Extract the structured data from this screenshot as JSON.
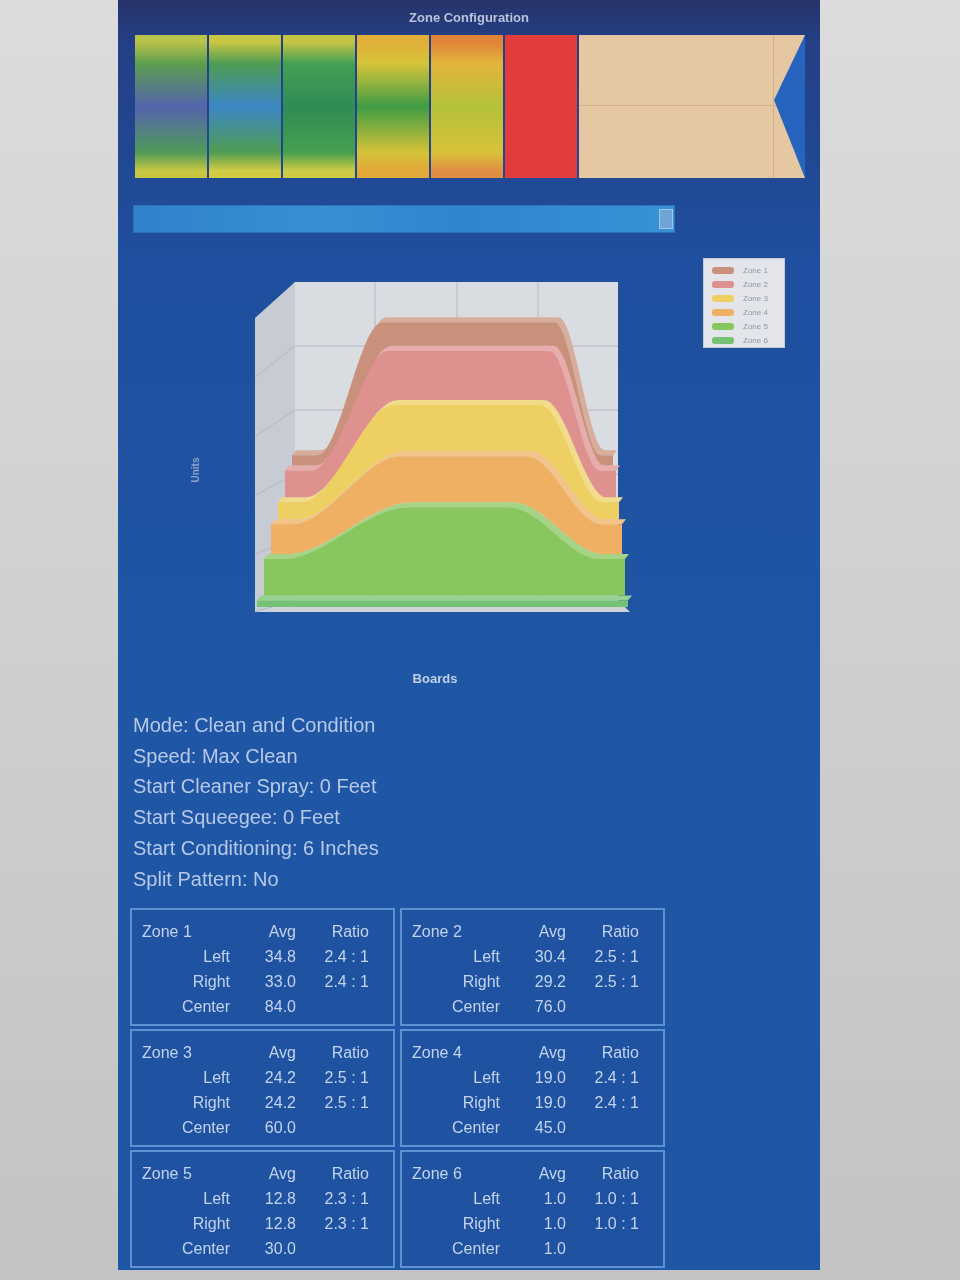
{
  "title": "Zone Configuration",
  "zone_strip": {
    "bars": [
      {
        "stripes": [
          {
            "color": "#b9c24a"
          },
          {
            "color": "#5c9e4e"
          },
          {
            "color": "#5464ac"
          },
          {
            "color": "#4f9a5a"
          },
          {
            "color": "#c7c640"
          }
        ]
      },
      {
        "stripes": [
          {
            "color": "#c8c645"
          },
          {
            "color": "#4e9c52"
          },
          {
            "color": "#3c86c4"
          },
          {
            "color": "#4f9c52"
          },
          {
            "color": "#d2cc42"
          }
        ]
      },
      {
        "stripes": [
          {
            "color": "#c4c444"
          },
          {
            "color": "#44a052"
          },
          {
            "color": "#2f8c56"
          },
          {
            "color": "#46a050"
          },
          {
            "color": "#cccc44"
          }
        ]
      },
      {
        "stripes": [
          {
            "color": "#e0b038"
          },
          {
            "color": "#d6c43a"
          },
          {
            "color": "#3f9c44"
          },
          {
            "color": "#d4c238"
          },
          {
            "color": "#e2a838"
          }
        ]
      },
      {
        "stripes": [
          {
            "color": "#e0843a"
          },
          {
            "color": "#e2b43a"
          },
          {
            "color": "#b4c23a"
          },
          {
            "color": "#d8c23a"
          },
          {
            "color": "#e08e44"
          }
        ]
      },
      {
        "stripes": [
          {
            "color": "#e23c3c"
          }
        ]
      }
    ]
  },
  "position_slider": {
    "level": 1
  },
  "chart": {
    "y_axis_title": "Units",
    "x_axis_title": "Boards",
    "legend": [
      {
        "label": "Zone 1",
        "color": "#c9917b"
      },
      {
        "label": "Zone 2",
        "color": "#df9190"
      },
      {
        "label": "Zone 3",
        "color": "#eed062"
      },
      {
        "label": "Zone 4",
        "color": "#efb063"
      },
      {
        "label": "Zone 5",
        "color": "#88c65e"
      },
      {
        "label": "Zone 6",
        "color": "#74c272"
      }
    ]
  },
  "settings": [
    "Mode: Clean and Condition",
    "Speed: Max Clean",
    "Start Cleaner Spray: 0 Feet",
    "Start Squeegee: 0 Feet",
    "Start Conditioning: 6 Inches",
    "Split Pattern: No"
  ],
  "zones": [
    {
      "name": "Zone 1",
      "columns": [
        "Avg",
        "Ratio"
      ],
      "rows": [
        {
          "label": "Left",
          "avg": "34.8",
          "ratio": "2.4 : 1"
        },
        {
          "label": "Right",
          "avg": "33.0",
          "ratio": "2.4 : 1"
        },
        {
          "label": "Center",
          "avg": "84.0"
        }
      ]
    },
    {
      "name": "Zone 2",
      "columns": [
        "Avg",
        "Ratio"
      ],
      "rows": [
        {
          "label": "Left",
          "avg": "30.4",
          "ratio": "2.5 : 1"
        },
        {
          "label": "Right",
          "avg": "29.2",
          "ratio": "2.5 : 1"
        },
        {
          "label": "Center",
          "avg": "76.0"
        }
      ]
    },
    {
      "name": "Zone 3",
      "columns": [
        "Avg",
        "Ratio"
      ],
      "rows": [
        {
          "label": "Left",
          "avg": "24.2",
          "ratio": "2.5 : 1"
        },
        {
          "label": "Right",
          "avg": "24.2",
          "ratio": "2.5 : 1"
        },
        {
          "label": "Center",
          "avg": "60.0"
        }
      ]
    },
    {
      "name": "Zone 4",
      "columns": [
        "Avg",
        "Ratio"
      ],
      "rows": [
        {
          "label": "Left",
          "avg": "19.0",
          "ratio": "2.4 : 1"
        },
        {
          "label": "Right",
          "avg": "19.0",
          "ratio": "2.4 : 1"
        },
        {
          "label": "Center",
          "avg": "45.0"
        }
      ]
    },
    {
      "name": "Zone 5",
      "columns": [
        "Avg",
        "Ratio"
      ],
      "rows": [
        {
          "label": "Left",
          "avg": "12.8",
          "ratio": "2.3 : 1"
        },
        {
          "label": "Right",
          "avg": "12.8",
          "ratio": "2.3 : 1"
        },
        {
          "label": "Center",
          "avg": "30.0"
        }
      ]
    },
    {
      "name": "Zone 6",
      "columns": [
        "Avg",
        "Ratio"
      ],
      "rows": [
        {
          "label": "Left",
          "avg": "1.0",
          "ratio": "1.0 : 1"
        },
        {
          "label": "Right",
          "avg": "1.0",
          "ratio": "1.0 : 1"
        },
        {
          "label": "Center",
          "avg": "1.0"
        }
      ]
    }
  ]
}
